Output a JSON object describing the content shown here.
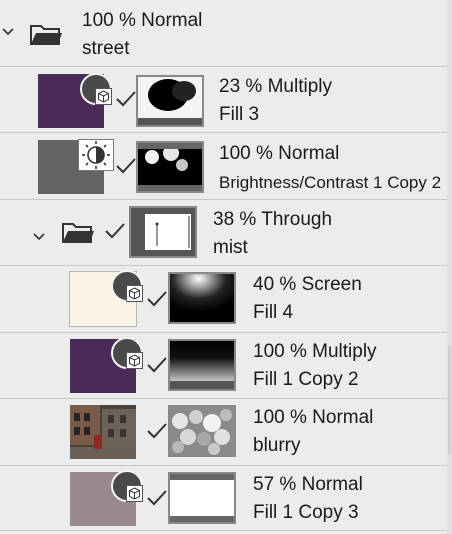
{
  "layers": [
    {
      "id": "street",
      "opacity": "100 %",
      "blend": "Normal",
      "name": "street",
      "type": "group"
    },
    {
      "id": "fill3",
      "opacity": "23 %",
      "blend": "Multiply",
      "name": "Fill 3",
      "type": "fill",
      "color": "#4a2a56"
    },
    {
      "id": "brightness",
      "opacity": "100 %",
      "blend": "Normal",
      "name": "Brightness/Contrast 1 Copy 2",
      "type": "adjustment",
      "color": "#636363"
    },
    {
      "id": "mist",
      "opacity": "38 %",
      "blend": "Through",
      "name": "mist",
      "type": "group"
    },
    {
      "id": "fill4",
      "opacity": "40 %",
      "blend": "Screen",
      "name": "Fill 4",
      "type": "fill",
      "color": "#faf4e4"
    },
    {
      "id": "fill1copy2",
      "opacity": "100 %",
      "blend": "Multiply",
      "name": "Fill 1 Copy 2",
      "type": "fill",
      "color": "#4a2a56"
    },
    {
      "id": "blurry",
      "opacity": "100 %",
      "blend": "Normal",
      "name": "blurry",
      "type": "raster"
    },
    {
      "id": "fill1copy3",
      "opacity": "57 %",
      "blend": "Normal",
      "name": "Fill 1 Copy 3",
      "type": "fill",
      "color": "#9a8a90"
    }
  ],
  "icons": {
    "expand": "chevron-down-icon",
    "folder": "folder-icon",
    "fill_badge": "fill-layer-icon",
    "adjustment_badge": "brightness-contrast-icon",
    "visible": "checkmark-icon"
  }
}
